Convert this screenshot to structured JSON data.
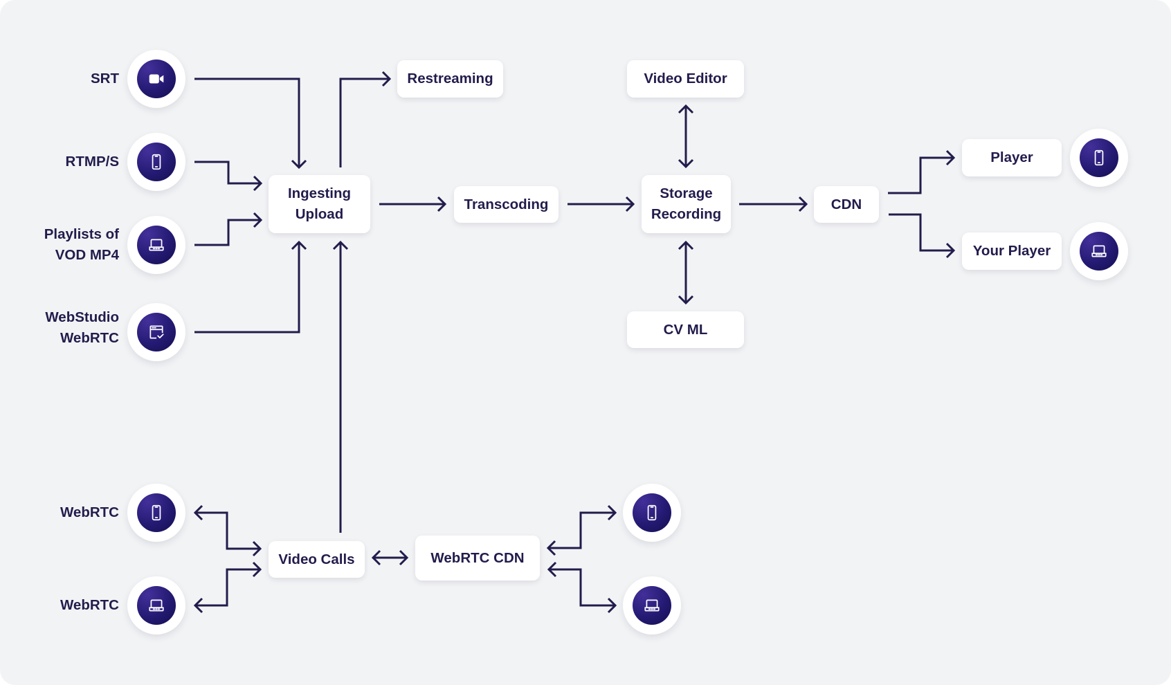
{
  "colors": {
    "background": "#f2f3f5",
    "line": "#221c4c",
    "node_fill": "#241a73",
    "box": "#ffffff"
  },
  "inputs": [
    {
      "label": "SRT",
      "icon": "video-camera-icon"
    },
    {
      "label": "RTMP/S",
      "icon": "smartphone-icon"
    },
    {
      "label": "Playlists of\nVOD MP4",
      "icon": "laptop-icon"
    },
    {
      "label": "WebStudio\nWebRTC",
      "icon": "browser-check-icon"
    }
  ],
  "webrtc_clients": [
    {
      "label": "WebRTC",
      "icon": "smartphone-icon"
    },
    {
      "label": "WebRTC",
      "icon": "laptop-icon"
    }
  ],
  "boxes": {
    "ingesting": "Ingesting\nUpload",
    "restreaming": "Restreaming",
    "transcoding": "Transcoding",
    "video_editor": "Video Editor",
    "storage": "Storage\nRecording",
    "cv_ml": "CV ML",
    "cdn": "CDN",
    "player": "Player",
    "your_player": "Your Player",
    "video_calls": "Video Calls",
    "webrtc_cdn": "WebRTC CDN"
  },
  "outputs": [
    {
      "target": "Player",
      "icon": "smartphone-icon"
    },
    {
      "target": "Your Player",
      "icon": "laptop-icon"
    }
  ],
  "webrtc_cdn_clients": [
    {
      "icon": "smartphone-icon"
    },
    {
      "icon": "laptop-icon"
    }
  ]
}
